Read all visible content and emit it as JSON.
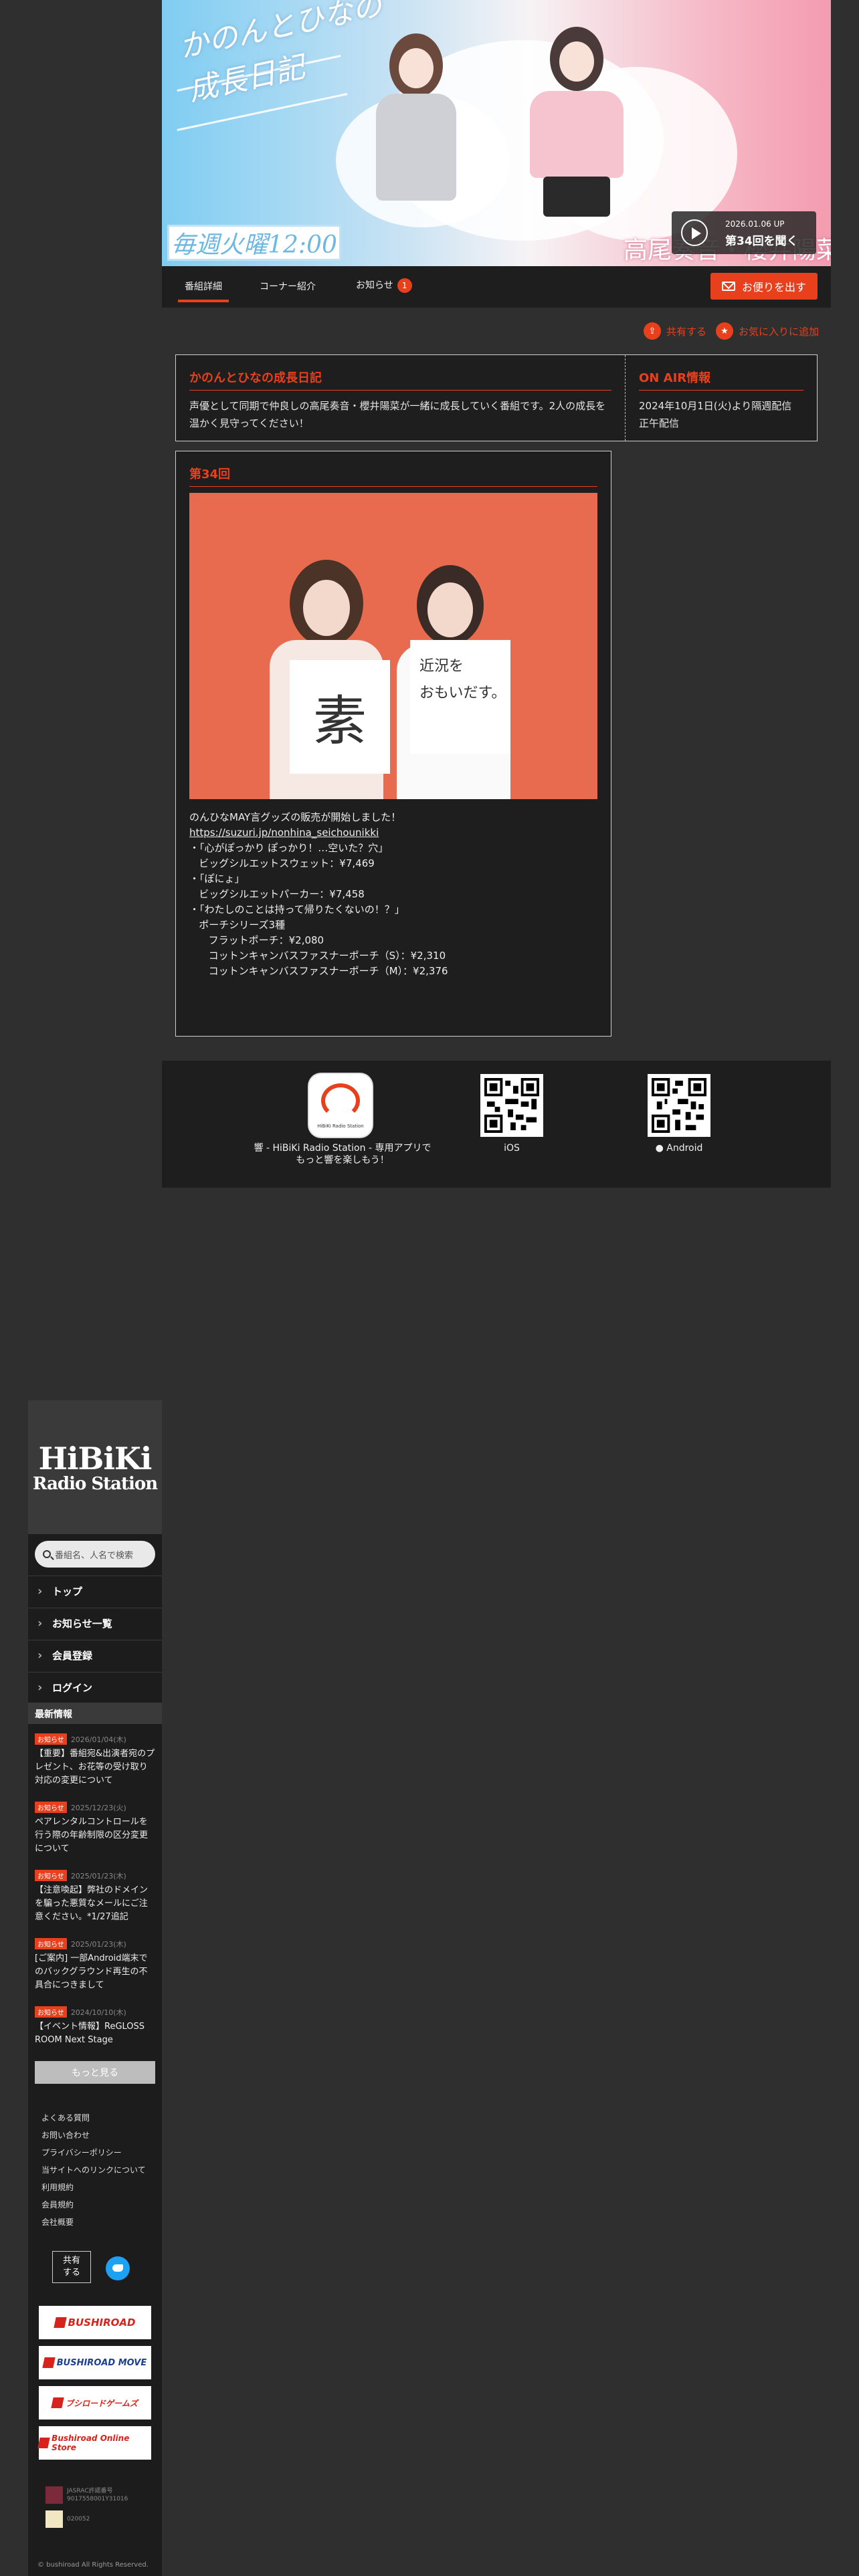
{
  "hero": {
    "title": "かのんとひなの\n成長日記",
    "schedule": "毎週火曜12:00",
    "names": "高尾奏音・櫻井陽菜",
    "play_date": "2026.01.06 UP",
    "play_label": "第34回を聞く"
  },
  "tabs": [
    {
      "label": "番組詳細",
      "active": true
    },
    {
      "label": "コーナー紹介",
      "active": false
    },
    {
      "label": "お知らせ",
      "badge": "1",
      "active": false
    }
  ],
  "letter_button": "お便りを出す",
  "actions": {
    "share": "共有する",
    "favorite": "お気に入りに追加"
  },
  "program": {
    "title": "かのんとひなの成長日記",
    "description": "声優として同期で仲良しの高尾奏音・櫻井陽菜が一緒に成長していく番組です。2人の成長を温かく見守ってください！",
    "onair_heading": "ON AIR情報",
    "onair_text": "2024年10月1日(火)より隔週配信\n正午配信"
  },
  "episode": {
    "title": "第34回",
    "photo_board_left": "素",
    "photo_board_right": "近況を\nおもいだす。",
    "lines": [
      "のんひなMAY言グッズの販売が開始しました！",
      "https://suzuri.jp/nonhina_seichounikki",
      "・「心がぽっかり ぽっかり！…空いた？穴」",
      "   ビッグシルエットスウェット：¥7,469",
      "・「ぽにょ」",
      "   ビッグシルエットパーカー：¥7,458",
      "・「わたしのことは持って帰りたくないの！？」",
      "   ポーチシリーズ3種",
      "      フラットポーチ：¥2,080",
      "      コットンキャンバスファスナーポーチ（S）：¥2,310",
      "      コットンキャンバスファスナーポーチ（M）：¥2,376"
    ]
  },
  "apps": {
    "caption": "響 - HiBiKi Radio Station - 専用アプリで\nもっと響を楽しもう！",
    "app_logo_text": "HiBiKi Radio Station",
    "ios": "iOS",
    "android": "Android"
  },
  "sidebar": {
    "logo_line1": "HiBiKi",
    "logo_line2": "Radio Station",
    "search_placeholder": "番組名、人名で検索",
    "nav": [
      "トップ",
      "お知らせ一覧",
      "会員登録",
      "ログイン"
    ],
    "news_heading": "最新情報",
    "news": [
      {
        "badge": "お知らせ",
        "date": "2026/01/04(木)",
        "text": "【重要】番組宛&出演者宛のプレゼント、お花等の受け取り対応の変更について"
      },
      {
        "badge": "お知らせ",
        "date": "2025/12/23(火)",
        "text": "ペアレンタルコントロールを行う際の年齢制限の区分変更について"
      },
      {
        "badge": "お知らせ",
        "date": "2025/01/23(木)",
        "text": "【注意喚起】弊社のドメインを騙った悪質なメールにご注意ください。*1/27追記"
      },
      {
        "badge": "お知らせ",
        "date": "2025/01/23(木)",
        "text": "[ご案内] 一部Android端末でのバックグラウンド再生の不具合につきまして"
      },
      {
        "badge": "お知らせ",
        "date": "2024/10/10(木)",
        "text": "【イベント情報】ReGLOSS ROOM Next Stage"
      }
    ],
    "more": "もっと見る",
    "links": [
      "よくある質問",
      "お問い合わせ",
      "プライバシーポリシー",
      "当サイトへのリンクについて",
      "利用規約",
      "会員規約",
      "会社概要"
    ],
    "share": "共有\nする",
    "banners": [
      "BUSHIROAD",
      "BUSHIROAD MOVE",
      "ブシロードゲームズ",
      "Bushiroad Online Store"
    ],
    "jasrac1": "JASRAC許諾番号\n9017558001Y31016",
    "jasrac2": "020052",
    "copyright": "© bushiroad All Rights Reserved."
  },
  "colors": {
    "accent": "#e8401c",
    "panel": "#1e1e1e",
    "background": "#2f2f2f"
  }
}
